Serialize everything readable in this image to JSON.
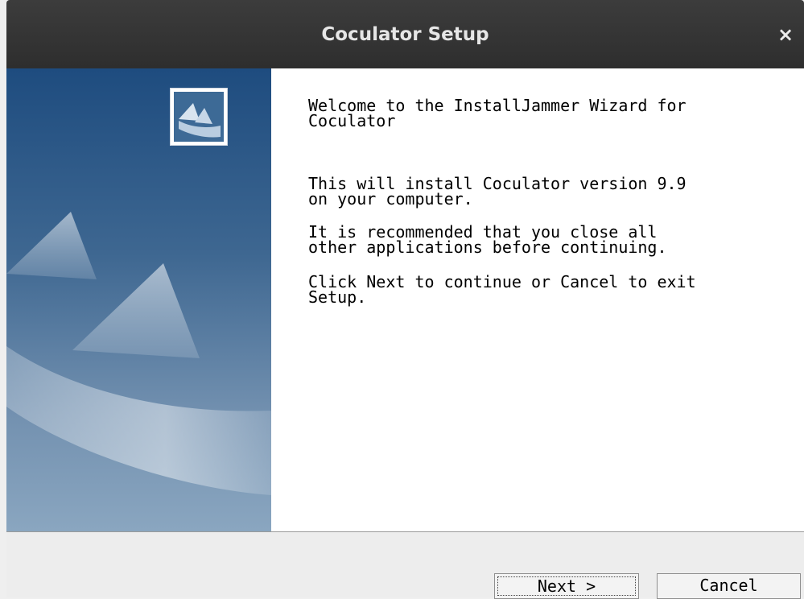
{
  "window": {
    "title": "Coculator Setup",
    "close_symbol": "×"
  },
  "sidebar": {
    "logo_icon": "installjammer-logo-icon"
  },
  "content": {
    "heading": "Welcome to the InstallJammer Wizard for\nCoculator",
    "paragraphs": [
      "This will install Coculator version 9.9\non your computer.",
      "It is recommended that you close all\nother applications before continuing.",
      "Click Next to continue or Cancel to exit\nSetup."
    ]
  },
  "buttons": {
    "next": "Next >",
    "cancel": "Cancel"
  },
  "colors": {
    "titlebar": "#333333",
    "sidebar_top": "#1e4c7f",
    "sidebar_bottom": "#8aa6c0",
    "content_bg": "#ffffff"
  }
}
